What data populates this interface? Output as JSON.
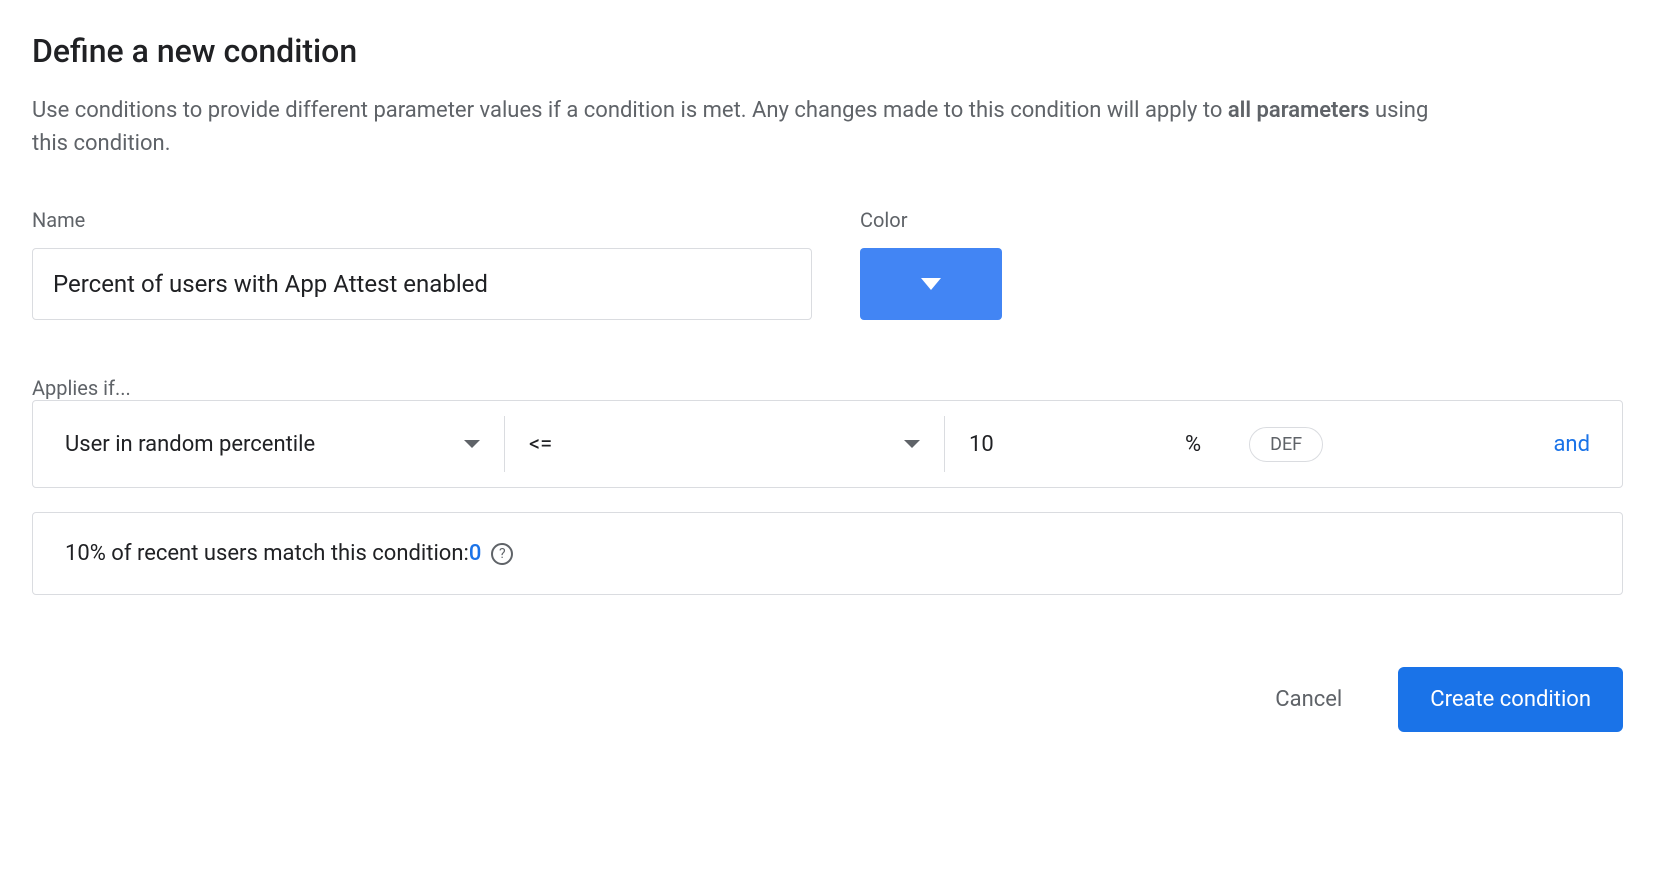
{
  "title": "Define a new condition",
  "description": {
    "text_before": "Use conditions to provide different parameter values if a condition is met. Any changes made to this condition will apply to ",
    "bold_text": "all parameters",
    "text_after": " using this condition."
  },
  "fields": {
    "name_label": "Name",
    "name_value": "Percent of users with App Attest enabled",
    "color_label": "Color",
    "color_value": "#4285f4"
  },
  "applies": {
    "label": "Applies if...",
    "selector": "User in random percentile",
    "operator": "<=",
    "value": "10",
    "unit": "%",
    "def_label": "DEF",
    "and_label": "and"
  },
  "match": {
    "text": "10% of recent users match this condition: ",
    "count": "0"
  },
  "buttons": {
    "cancel": "Cancel",
    "create": "Create condition"
  }
}
